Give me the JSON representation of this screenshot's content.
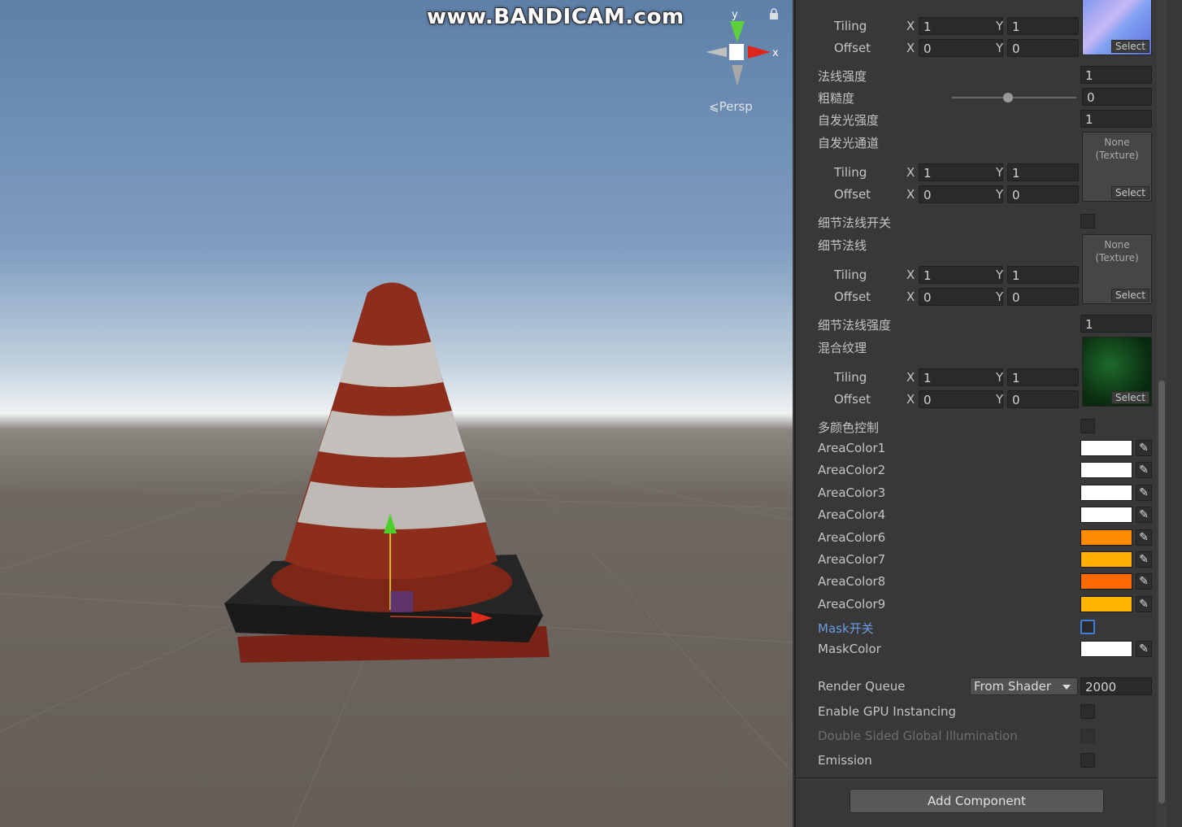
{
  "scene": {
    "watermark": "www.BANDICAM.com",
    "gizmo": {
      "y_label": "y",
      "x_label": "x",
      "projection": "Persp"
    }
  },
  "inspector": {
    "top_texture": {
      "tiling_x": "1",
      "tiling_y": "1",
      "offset_x": "0",
      "offset_y": "0",
      "select": "Select"
    },
    "common": {
      "tiling": "Tiling",
      "offset": "Offset",
      "x": "X",
      "y": "Y"
    },
    "normal_strength": {
      "label": "法线强度",
      "value": "1"
    },
    "roughness": {
      "label": "粗糙度",
      "value": "0",
      "slider_fraction": 0.45
    },
    "emission_strength": {
      "label": "自发光强度",
      "value": "1"
    },
    "emission_channel": {
      "label": "自发光通道",
      "texture_none": "None",
      "texture_type": "(Texture)",
      "select": "Select",
      "tiling_x": "1",
      "tiling_y": "1",
      "offset_x": "0",
      "offset_y": "0"
    },
    "detail_normal_toggle": {
      "label": "细节法线开关"
    },
    "detail_normal": {
      "label": "细节法线",
      "texture_none": "None",
      "texture_type": "(Texture)",
      "select": "Select",
      "tiling_x": "1",
      "tiling_y": "1",
      "offset_x": "0",
      "offset_y": "0"
    },
    "detail_normal_strength": {
      "label": "细节法线强度",
      "value": "1"
    },
    "blend_texture": {
      "label": "混合纹理",
      "select": "Select",
      "tiling_x": "1",
      "tiling_y": "1",
      "offset_x": "0",
      "offset_y": "0"
    },
    "multi_color": {
      "label": "多颜色控制"
    },
    "area_colors": [
      {
        "label": "AreaColor1",
        "color": "#ffffff"
      },
      {
        "label": "AreaColor2",
        "color": "#ffffff"
      },
      {
        "label": "AreaColor3",
        "color": "#ffffff"
      },
      {
        "label": "AreaColor4",
        "color": "#ffffff"
      },
      {
        "label": "AreaColor6",
        "color": "#ff8c00"
      },
      {
        "label": "AreaColor7",
        "color": "#ffb000"
      },
      {
        "label": "AreaColor8",
        "color": "#ff6a00"
      },
      {
        "label": "AreaColor9",
        "color": "#ffb400"
      }
    ],
    "mask_toggle": {
      "label": "Mask开关"
    },
    "mask_color": {
      "label": "MaskColor",
      "color": "#ffffff"
    },
    "render_queue": {
      "label": "Render Queue",
      "mode": "From Shader",
      "value": "2000"
    },
    "gpu_instancing": {
      "label": "Enable GPU Instancing"
    },
    "double_sided_gi": {
      "label": "Double Sided Global Illumination"
    },
    "emission": {
      "label": "Emission"
    },
    "add_component": "Add Component"
  }
}
